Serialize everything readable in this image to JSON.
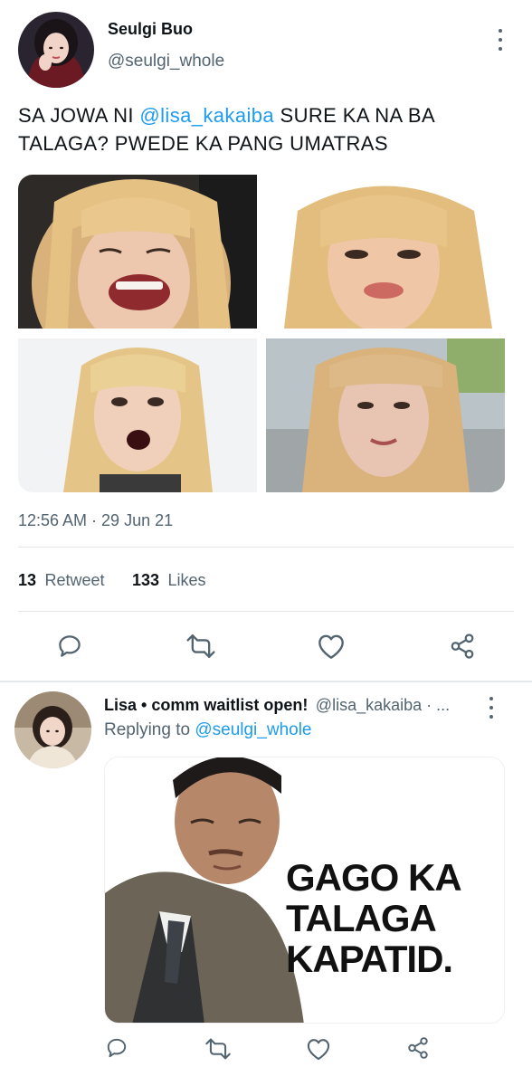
{
  "tweet": {
    "author_name": "Seulgi Buo",
    "author_handle": "@seulgi_whole",
    "text_part1": "SA JOWA NI ",
    "text_mention": "@lisa_kakaiba",
    "text_part2": " SURE KA NA BA TALAGA? PWEDE KA PANG UMATRAS",
    "timestamp": "12:56 AM · 29 Jun 21",
    "retweet_count": "13",
    "retweet_label": "Retweet",
    "likes_count": "133",
    "likes_label": "Likes",
    "media_icons": [
      "photo-1",
      "photo-2",
      "photo-3",
      "photo-4"
    ]
  },
  "actions": {
    "icons": [
      "reply-icon",
      "retweet-icon",
      "like-icon",
      "share-icon"
    ]
  },
  "reply": {
    "author_name": "Lisa • comm waitlist open!",
    "author_handle": "@lisa_kakaiba · ...",
    "replying_to_prefix": "Replying to ",
    "replying_to_handle": "@seulgi_whole",
    "meme_line1": "GAGO KA",
    "meme_line2": "TALAGA",
    "meme_line3": "KAPATID."
  },
  "colors": {
    "accent": "#1d9bf0",
    "text": "#0f1419",
    "muted": "#536471",
    "divider": "#e5e8eb"
  }
}
